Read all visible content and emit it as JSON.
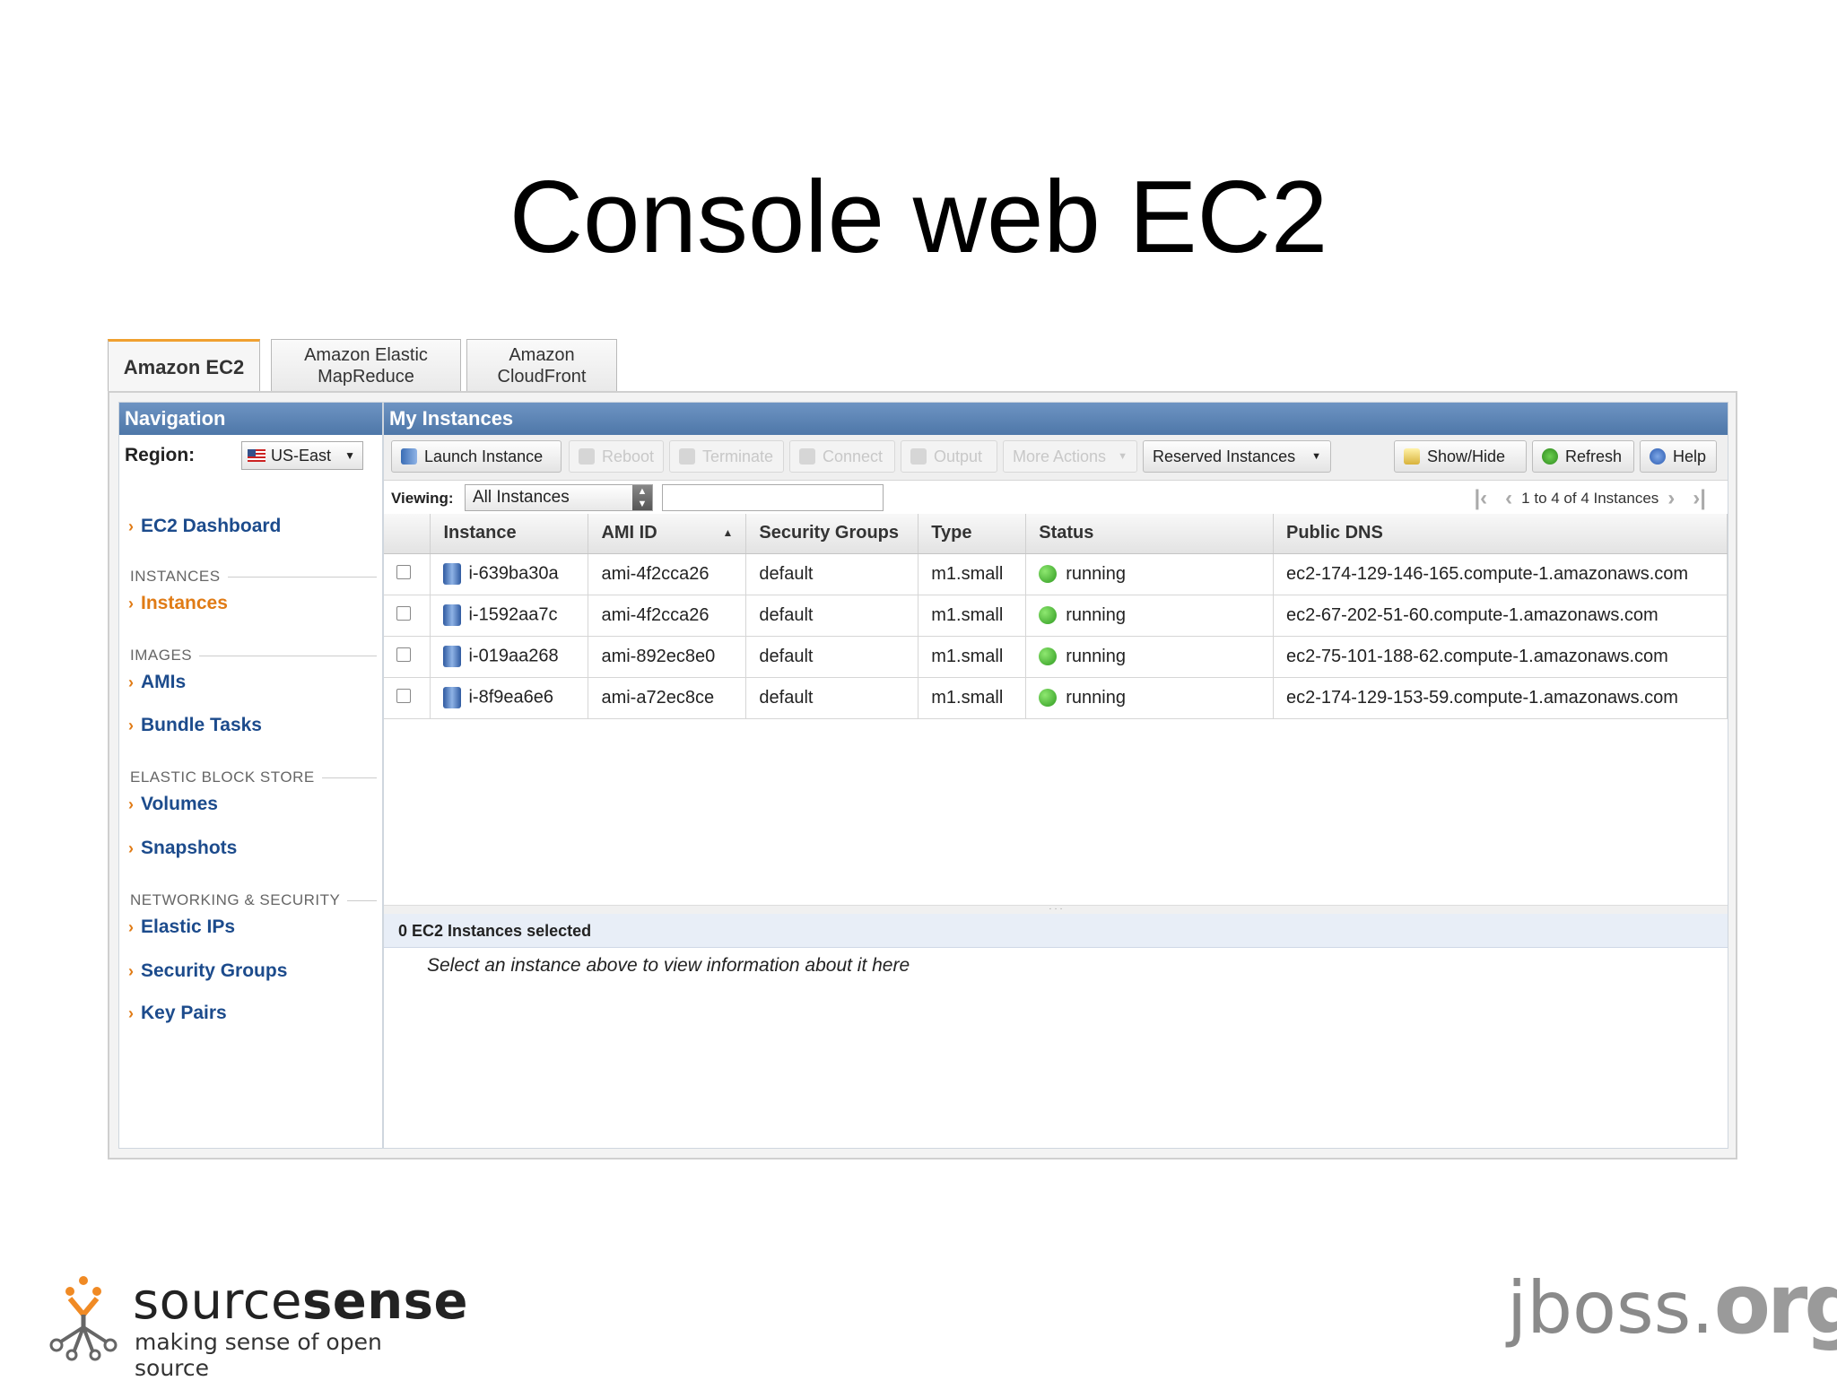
{
  "slide_title": "Console web EC2",
  "tabs": [
    {
      "label": "Amazon EC2"
    },
    {
      "label": "Amazon Elastic MapReduce"
    },
    {
      "label": "Amazon CloudFront"
    }
  ],
  "sidebar": {
    "header": "Navigation",
    "region_label": "Region:",
    "region_value": "US-East",
    "dashboard": "EC2 Dashboard",
    "sections": {
      "instances": "INSTANCES",
      "images": "IMAGES",
      "ebs": "ELASTIC BLOCK STORE",
      "networking": "NETWORKING & SECURITY"
    },
    "links": {
      "instances": "Instances",
      "amis": "AMIs",
      "bundle_tasks": "Bundle Tasks",
      "volumes": "Volumes",
      "snapshots": "Snapshots",
      "elastic_ips": "Elastic IPs",
      "security_groups": "Security Groups",
      "key_pairs": "Key Pairs"
    }
  },
  "main": {
    "header": "My Instances",
    "toolbar": {
      "launch": "Launch Instance",
      "reboot": "Reboot",
      "terminate": "Terminate",
      "connect": "Connect",
      "output": "Output",
      "more_actions": "More Actions",
      "reserved": "Reserved Instances",
      "showhide": "Show/Hide",
      "refresh": "Refresh",
      "help": "Help"
    },
    "viewing_label": "Viewing:",
    "viewing_value": "All Instances",
    "pager_text": "1 to 4 of 4 Instances",
    "columns": [
      "Instance",
      "AMI ID",
      "Security Groups",
      "Type",
      "Status",
      "Public DNS"
    ],
    "rows": [
      {
        "instance": "i-639ba30a",
        "ami": "ami-4f2cca26",
        "group": "default",
        "type": "m1.small",
        "status": "running",
        "dns": "ec2-174-129-146-165.compute-1.amazonaws.com"
      },
      {
        "instance": "i-1592aa7c",
        "ami": "ami-4f2cca26",
        "group": "default",
        "type": "m1.small",
        "status": "running",
        "dns": "ec2-67-202-51-60.compute-1.amazonaws.com"
      },
      {
        "instance": "i-019aa268",
        "ami": "ami-892ec8e0",
        "group": "default",
        "type": "m1.small",
        "status": "running",
        "dns": "ec2-75-101-188-62.compute-1.amazonaws.com"
      },
      {
        "instance": "i-8f9ea6e6",
        "ami": "ami-a72ec8ce",
        "group": "default",
        "type": "m1.small",
        "status": "running",
        "dns": "ec2-174-129-153-59.compute-1.amazonaws.com"
      }
    ],
    "detail_header": "0 EC2 Instances selected",
    "detail_text": "Select an instance above to view information about it here"
  },
  "footer": {
    "sourcesense_name_a": "source",
    "sourcesense_name_b": "sense",
    "sourcesense_tag": "making sense of open source",
    "jboss_a": "jboss.",
    "jboss_b": "org"
  }
}
